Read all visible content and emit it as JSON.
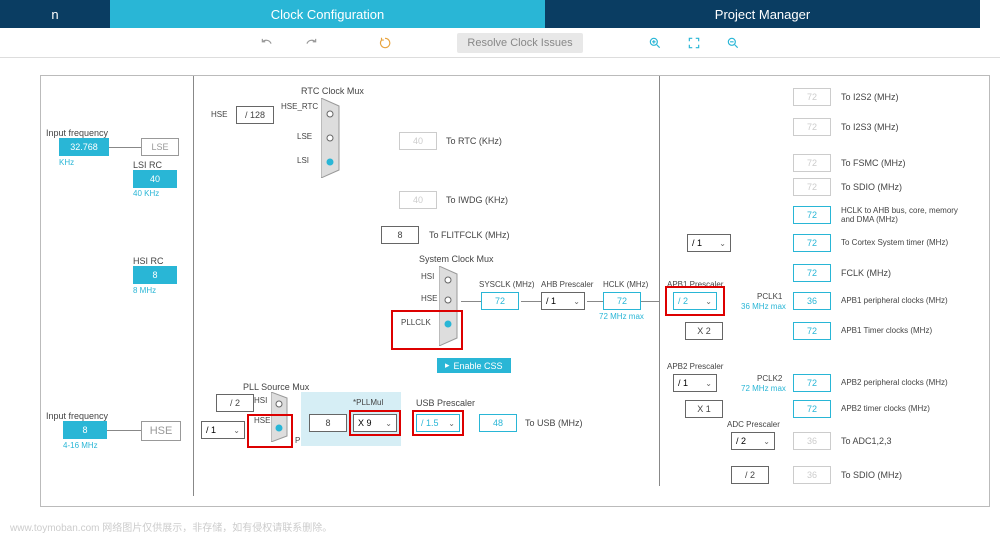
{
  "tabs": {
    "left": "n",
    "clock": "Clock Configuration",
    "project": "Project Manager"
  },
  "toolbar": {
    "resolve": "Resolve Clock Issues"
  },
  "inputs": {
    "lse_label": "Input frequency",
    "lse_val": "32.768",
    "lse_unit": "KHz",
    "lse_box": "LSE",
    "lsi_label": "LSI RC",
    "lsi_val": "40",
    "lsi_note": "40 KHz",
    "hsi_label": "HSI RC",
    "hsi_val": "8",
    "hsi_note": "8 MHz",
    "hse_label": "Input frequency",
    "hse_val": "8",
    "hse_note": "4-16 MHz",
    "hse_box": "HSE"
  },
  "rtc": {
    "title": "RTC Clock Mux",
    "div128": "/ 128",
    "hse": "HSE",
    "hse_rtc": "HSE_RTC",
    "lse": "LSE",
    "lsi": "LSI",
    "out_val": "40",
    "out_lbl": "To RTC (KHz)"
  },
  "iwdg": {
    "val": "40",
    "lbl": "To IWDG (KHz)"
  },
  "flit": {
    "val": "8",
    "lbl": "To FLITFCLK (MHz)"
  },
  "sysmux": {
    "title": "System Clock Mux",
    "hsi": "HSI",
    "hse": "HSE",
    "pllclk": "PLLCLK",
    "css_btn": "Enable CSS"
  },
  "pll": {
    "title": "PLL Source Mux",
    "div2": "/ 2",
    "hsi_lbl": "HSI",
    "hse_lbl": "HSE",
    "pll_lbl": "PLL",
    "div1": "/ 1",
    "pll_in": "8",
    "mul_lbl": "*PLLMul",
    "mul_val": "X 9"
  },
  "usb": {
    "title": "USB Prescaler",
    "div": "/ 1.5",
    "val": "48",
    "lbl": "To USB (MHz)"
  },
  "sysclk": {
    "lbl": "SYSCLK (MHz)",
    "val": "72"
  },
  "ahb": {
    "title": "AHB Prescaler",
    "div": "/ 1",
    "hclk_lbl": "HCLK (MHz)",
    "hclk_val": "72",
    "note": "72 MHz max"
  },
  "outputs": {
    "i2s2": {
      "val": "72",
      "lbl": "To I2S2 (MHz)"
    },
    "i2s3": {
      "val": "72",
      "lbl": "To I2S3 (MHz)"
    },
    "fsmc": {
      "val": "72",
      "lbl": "To FSMC (MHz)"
    },
    "sdio": {
      "val": "72",
      "lbl": "To SDIO (MHz)"
    },
    "ahb": {
      "val": "72",
      "lbl": "HCLK to AHB bus, core, memory and DMA (MHz)"
    },
    "cortex_div": "/ 1",
    "cortex": {
      "val": "72",
      "lbl": "To Cortex System timer (MHz)"
    },
    "fclk": {
      "val": "72",
      "lbl": "FCLK (MHz)"
    }
  },
  "apb1": {
    "title": "APB1 Prescaler",
    "div": "/ 2",
    "pclk_lbl": "PCLK1",
    "note": "36 MHz max",
    "periph_val": "36",
    "periph_lbl": "APB1 peripheral clocks (MHz)",
    "timer_mul": "X 2",
    "timer_val": "72",
    "timer_lbl": "APB1 Timer clocks (MHz)"
  },
  "apb2": {
    "title": "APB2 Prescaler",
    "div": "/ 1",
    "pclk_lbl": "PCLK2",
    "note": "72 MHz max",
    "periph_val": "72",
    "periph_lbl": "APB2 peripheral clocks (MHz)",
    "timer_mul": "X 1",
    "timer_val": "72",
    "timer_lbl": "APB2 timer clocks (MHz)"
  },
  "adc": {
    "title": "ADC Prescaler",
    "div": "/ 2",
    "val": "36",
    "lbl": "To ADC1,2,3",
    "sdio_div": "/ 2",
    "sdio_val": "36",
    "sdio_lbl": "To SDIO (MHz)"
  },
  "watermark": "www.toymoban.com 网络图片仅供展示，非存储，如有侵权请联系删除。"
}
